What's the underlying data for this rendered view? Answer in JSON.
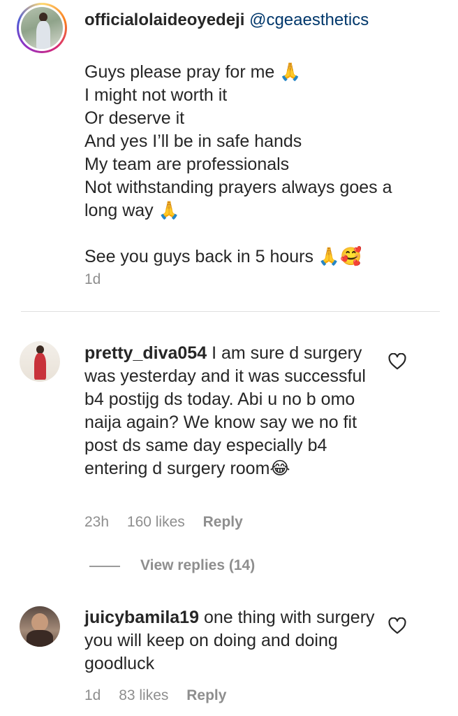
{
  "post": {
    "username": "officialolaideoyedeji",
    "mention": "@cgeaesthetics",
    "caption_lines": [
      "Guys please pray for me 🙏",
      "I might not worth it",
      "Or deserve it",
      "And yes I’ll be in safe hands",
      "My team are professionals",
      "Not withstanding prayers always goes a",
      "long way 🙏",
      "",
      "See you guys back in 5 hours 🙏🥰"
    ],
    "time": "1d"
  },
  "comments": [
    {
      "username": "pretty_diva054",
      "text": "I am sure d surgery was yesterday and it was successful b4 postijg ds today. Abi u no b omo naija again? We know say we no fit post ds same day especially b4 entering d surgery room😂",
      "time": "23h",
      "likes": "160 likes",
      "reply_label": "Reply",
      "view_replies": "View replies (14)"
    },
    {
      "username": "juicybamila19",
      "text": "one thing with surgery you will keep on doing and doing goodluck",
      "time": "1d",
      "likes": "83 likes",
      "reply_label": "Reply"
    }
  ],
  "icons": {
    "like": "heart-outline-icon"
  },
  "colors": {
    "username": "#262626",
    "mention": "#00376b",
    "meta": "#8e8e8e"
  }
}
